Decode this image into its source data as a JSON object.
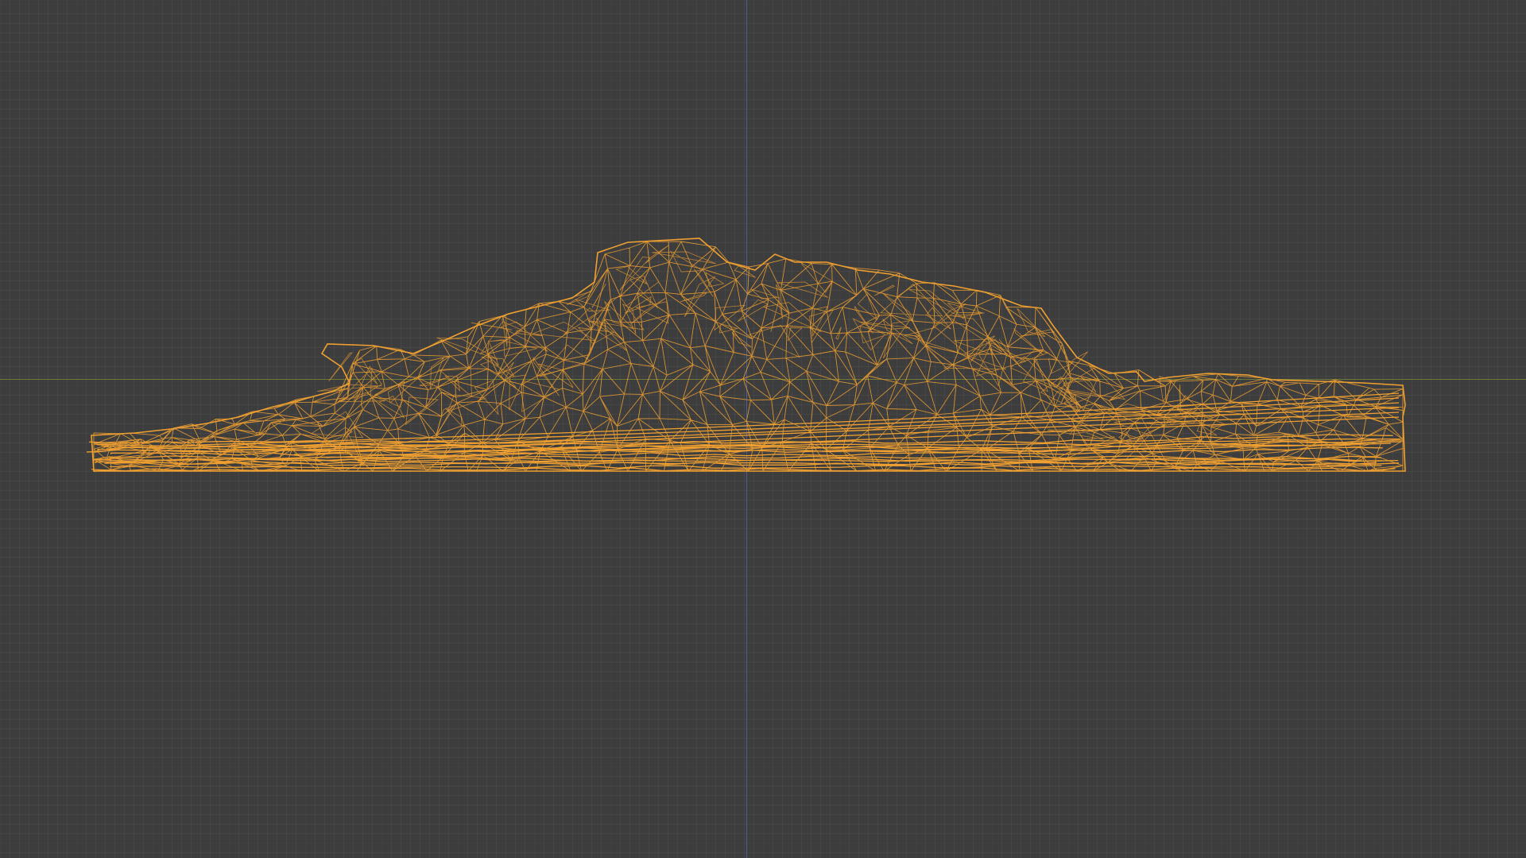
{
  "viewport": {
    "label": "3D viewport",
    "background_color": "#3d3d3d",
    "grid_color": "#474747",
    "x_axis_color": "#6f7a3a",
    "z_axis_color": "#4a5f93",
    "mesh": {
      "name": "wireframe-rock-mesh",
      "edge_color": "#f0a030",
      "display": "wireframe"
    }
  }
}
